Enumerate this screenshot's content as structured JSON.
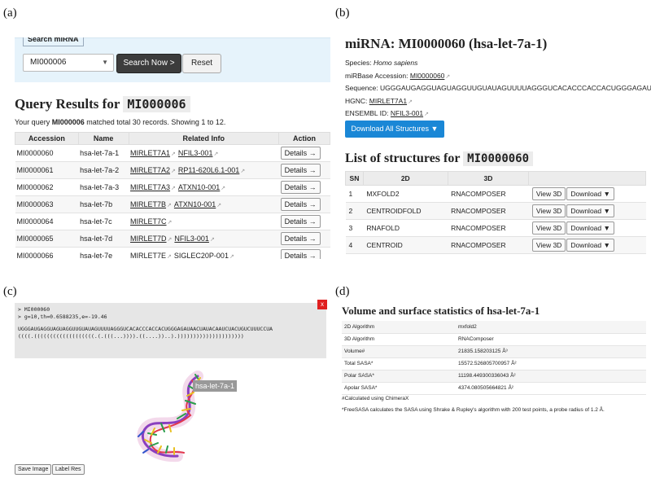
{
  "labels": {
    "a": "(a)",
    "b": "(b)",
    "c": "(c)",
    "d": "(d)"
  },
  "search": {
    "legend": "Search miRNA",
    "value": "MI000006",
    "submit_label": "Search Now >",
    "reset_label": "Reset"
  },
  "results": {
    "title_prefix": "Query Results for",
    "query": "MI000006",
    "summary_prefix": "Your query",
    "summary_suffix": "matched total 30 records. Showing 1 to 12.",
    "columns": [
      "Accession",
      "Name",
      "Related Info",
      "Action"
    ],
    "details_label": "Details →",
    "rows": [
      {
        "accession": "MI0000060",
        "name": "hsa-let-7a-1",
        "info1": "MIRLET7A1",
        "info2": "NFIL3-001"
      },
      {
        "accession": "MI0000061",
        "name": "hsa-let-7a-2",
        "info1": "MIRLET7A2",
        "info2": "RP11-620L6.1-001"
      },
      {
        "accession": "MI0000062",
        "name": "hsa-let-7a-3",
        "info1": "MIRLET7A3",
        "info2": "ATXN10-001"
      },
      {
        "accession": "MI0000063",
        "name": "hsa-let-7b",
        "info1": "MIRLET7B",
        "info2": "ATXN10-001"
      },
      {
        "accession": "MI0000064",
        "name": "hsa-let-7c",
        "info1": "MIRLET7C",
        "info2": ""
      },
      {
        "accession": "MI0000065",
        "name": "hsa-let-7d",
        "info1": "MIRLET7D",
        "info2": "NFIL3-001"
      },
      {
        "accession": "MI0000066",
        "name": "hsa-let-7e",
        "info1": "MIRLET7E",
        "info2": "SIGLEC20P-001"
      }
    ]
  },
  "mirna": {
    "title": "miRNA: MI0000060 (hsa-let-7a-1)",
    "species_label": "Species:",
    "species": "Homo sapiens",
    "accession_label": "miRBase Accession:",
    "accession": "MI0000060",
    "sequence_label": "Sequence:",
    "sequence": "UGGGAUGAGGUAGUAGGUUGUAUAGUUUUAGGGUCACACCCACCACUGGGAGAU...",
    "hgnc_label": "HGNC:",
    "hgnc": "MIRLET7A1",
    "ensembl_label": "ENSEMBL ID:",
    "ensembl": "NFIL3-001",
    "download_all_label": "Download All Structures ▼"
  },
  "structures": {
    "title_prefix": "List of structures for",
    "id": "MI0000060",
    "columns": [
      "SN",
      "2D",
      "3D",
      ""
    ],
    "view_label": "View 3D",
    "download_label": "Download ▼",
    "rows": [
      {
        "sn": "1",
        "d2": "MXFOLD2",
        "d3": "RNACOMPOSER"
      },
      {
        "sn": "2",
        "d2": "CENTROIDFOLD",
        "d3": "RNACOMPOSER"
      },
      {
        "sn": "3",
        "d2": "RNAFOLD",
        "d3": "RNACOMPOSER"
      },
      {
        "sn": "4",
        "d2": "CENTROID",
        "d3": "RNACOMPOSER"
      }
    ]
  },
  "viewer": {
    "line1": "> MI000060",
    "line2": "> g=10,th=0.6588235,e=-19.46",
    "sequence": "UGGGAUGAGGUAGUAGGUUGUAUAGUUUUAGGGUCACACCCACCACUGGGAGAUAACUAUACAAUCUACUGUCUUUCCUA",
    "dotbracket": "((((.(((((((((((((((((((.(.(((...)))).((....))..).)))))))))))))))))))))",
    "close_label": "x",
    "mol_label": "hsa-let-7a-1",
    "save_label": "Save Image",
    "label_res_label": "Label Res"
  },
  "volume": {
    "title": "Volume and surface statistics of hsa-let-7a-1",
    "rows": [
      {
        "k": "2D Algorithm",
        "v": "mxfold2"
      },
      {
        "k": "3D Algorithm",
        "v": "RNAComposer"
      },
      {
        "k": "Volume#",
        "v": "21835.158203125 Å³"
      },
      {
        "k": "Total SASA*",
        "v": "15572.526805700957 Å²"
      },
      {
        "k": "Polar SASA*",
        "v": "11198.449300336043 Å²"
      },
      {
        "k": "Apolar SASA*",
        "v": "4374.080505664821 Å²"
      }
    ],
    "note1": "#Calculated using ChimeraX",
    "note2": "*FreeSASA calculates the SASA using Shrake & Rupley's algorithm with 200 test points, a probe radius of 1.2 Å."
  }
}
